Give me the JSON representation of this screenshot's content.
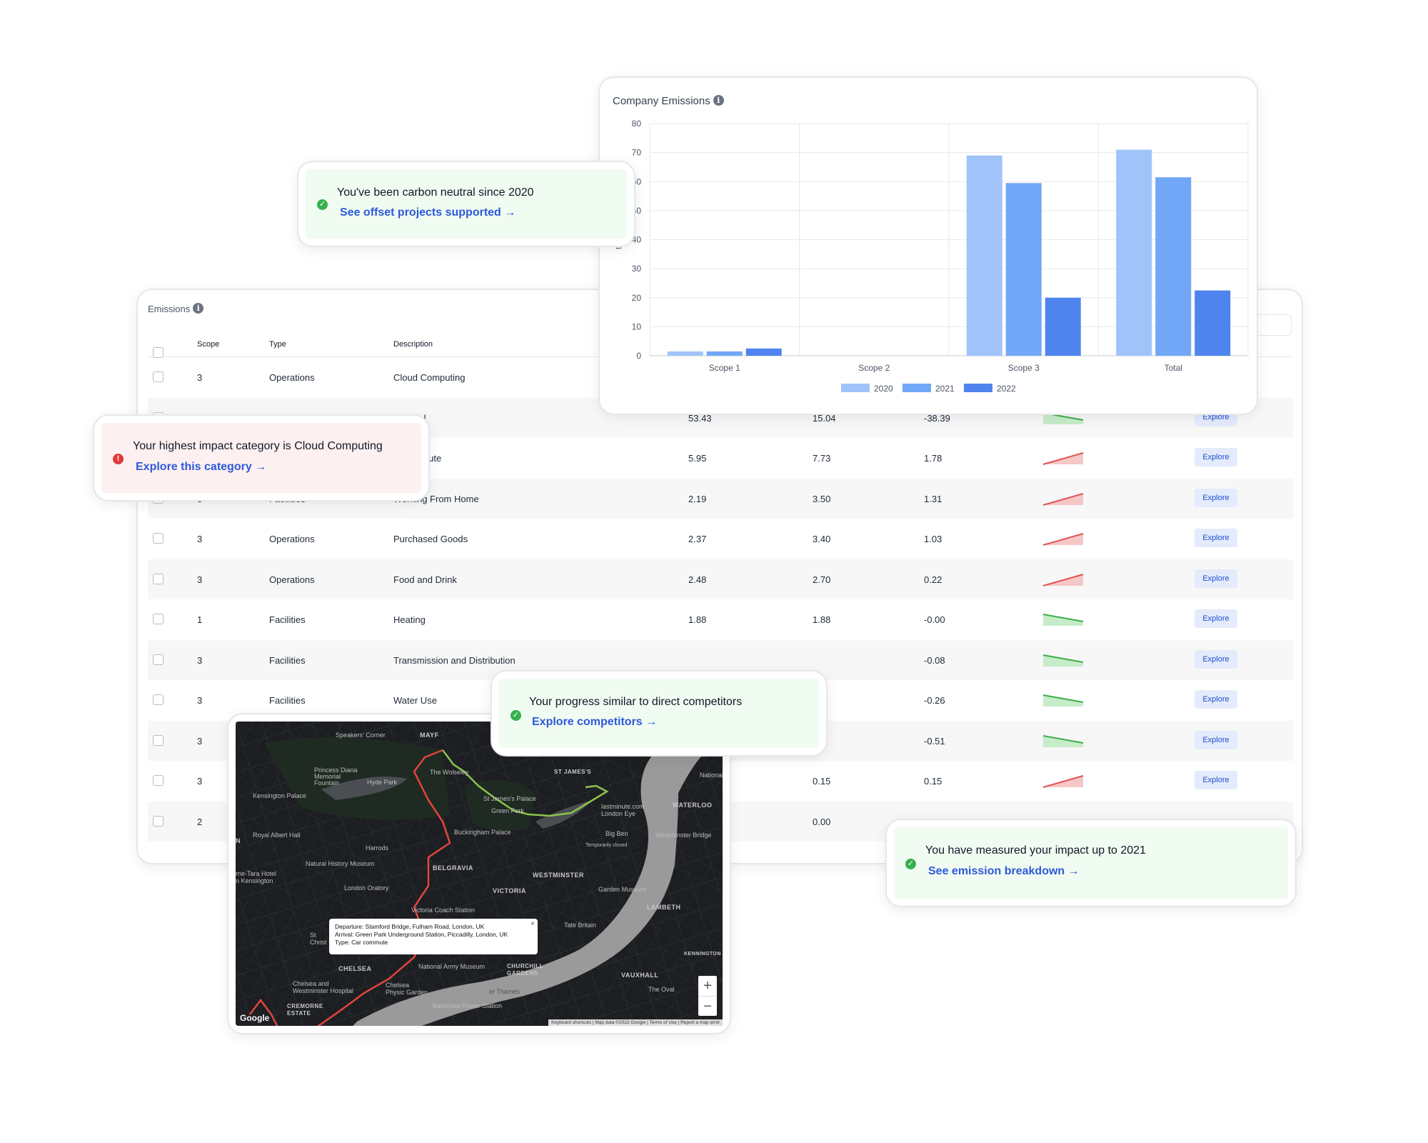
{
  "emissions_table": {
    "title": "Emissions",
    "columns": {
      "scope": "Scope",
      "type": "Type",
      "description": "Description"
    },
    "rows": [
      {
        "scope": "3",
        "type": "Operations",
        "description": "Cloud Computing",
        "v1": "",
        "v2": "",
        "v3": "",
        "trend": "",
        "explore": ""
      },
      {
        "scope": "",
        "type": "",
        "description": "s Travel",
        "v1": "53.43",
        "v2": "15.04",
        "v3": "-38.39",
        "trend": "down",
        "explore": "Explore"
      },
      {
        "scope": "",
        "type": "",
        "description": "e Commute",
        "v1": "5.95",
        "v2": "7.73",
        "v3": "1.78",
        "trend": "up",
        "explore": "Explore"
      },
      {
        "scope": "3",
        "type": "Facilities",
        "description": "Working From Home",
        "v1": "2.19",
        "v2": "3.50",
        "v3": "1.31",
        "trend": "up",
        "explore": "Explore"
      },
      {
        "scope": "3",
        "type": "Operations",
        "description": "Purchased Goods",
        "v1": "2.37",
        "v2": "3.40",
        "v3": "1.03",
        "trend": "up",
        "explore": "Explore"
      },
      {
        "scope": "3",
        "type": "Operations",
        "description": "Food and Drink",
        "v1": "2.48",
        "v2": "2.70",
        "v3": "0.22",
        "trend": "up",
        "explore": "Explore"
      },
      {
        "scope": "1",
        "type": "Facilities",
        "description": "Heating",
        "v1": "1.88",
        "v2": "1.88",
        "v3": "-0.00",
        "trend": "down",
        "explore": "Explore"
      },
      {
        "scope": "3",
        "type": "Facilities",
        "description": "Transmission and Distribution",
        "v1": "",
        "v2": "",
        "v3": "-0.08",
        "trend": "down",
        "explore": "Explore"
      },
      {
        "scope": "3",
        "type": "Facilities",
        "description": "Water Use",
        "v1": "",
        "v2": "",
        "v3": "-0.26",
        "trend": "down",
        "explore": "Explore"
      },
      {
        "scope": "3",
        "type": "",
        "description": "",
        "v1": "",
        "v2": "",
        "v3": "-0.51",
        "trend": "down",
        "explore": "Explore"
      },
      {
        "scope": "3",
        "type": "",
        "description": "",
        "v1": "",
        "v2": "0.15",
        "v3": "0.15",
        "trend": "up",
        "explore": "Explore"
      },
      {
        "scope": "2",
        "type": "",
        "description": "",
        "v1": "",
        "v2": "0.00",
        "v3": "",
        "trend": "",
        "explore": ""
      }
    ]
  },
  "chart_card": {
    "title": "Company Emissions"
  },
  "chart_data": {
    "type": "bar",
    "categories": [
      "Scope 1",
      "Scope 2",
      "Scope 3",
      "Total"
    ],
    "series": [
      {
        "name": "2020",
        "color": "#a0c4f9",
        "values": [
          1.5,
          0,
          69,
          71
        ]
      },
      {
        "name": "2021",
        "color": "#72a6f6",
        "values": [
          1.5,
          0,
          59.5,
          61.5
        ]
      },
      {
        "name": "2022",
        "color": "#4f84ee",
        "values": [
          2.5,
          0,
          20,
          22.5
        ]
      }
    ],
    "yticks": [
      0,
      10,
      20,
      30,
      40,
      50,
      60,
      70,
      80
    ],
    "ylim": [
      0,
      80
    ],
    "ylabel": "t(",
    "legend": "bottom",
    "grid": true
  },
  "notifications": {
    "neutral": {
      "title": "You've been carbon neutral since 2020",
      "link": "See offset projects supported →",
      "status": "success"
    },
    "impact": {
      "title": "Your highest impact category is Cloud Computing",
      "link": "Explore this category →",
      "status": "error"
    },
    "progress": {
      "title": "Your progress similar to direct competitors",
      "link": "Explore competitors →",
      "status": "success"
    },
    "measured": {
      "title": "You have measured your impact up to 2021",
      "link": "See emission breakdown →",
      "status": "success"
    }
  },
  "map": {
    "popup": {
      "departure": "Departure: Stamford Bridge, Fulham Road, London, UK",
      "arrival": "Arrival: Green Park Underground Station, Piccadilly, London, UK",
      "type": "Type: Car commute"
    },
    "labels": {
      "speakers_corner": "Speakers' Corner",
      "mayfair": "MAYF",
      "diana": "Princess Diana\nMemorial\nFountain",
      "hyde_park": "Hyde Park",
      "kensington_palace": "Kensington Palace",
      "wolseley": "The Wolseley",
      "st_james": "ST JAMES'S",
      "national": "National T",
      "st_james_palace": "St James's Palace",
      "green_park": "Green Park",
      "lastminute": "lastminute.com\nLondon Eye",
      "waterloo": "WATERLOO",
      "royal_albert": "Royal Albert Hall",
      "buckingham": "Buckingham Palace",
      "big_ben": "Big Ben",
      "westminster_bridge": "Westminster Bridge",
      "harrods": "Harrods",
      "nhm": "Natural History Museum",
      "belgravia": "BELGRAVIA",
      "westminster": "WESTMINSTER",
      "garden_museum": "Garden Museum",
      "hotel": "rne-Tara Hotel\nn Kensington",
      "oratory": "London Oratory",
      "victoria": "VICTORIA",
      "lambeth": "LAMBETH",
      "victoria_coach": "Victoria Coach Station",
      "tate": "Tate Britain",
      "chelsea": "CHELSEA",
      "national_army": "National Army Museum",
      "churchill": "CHURCHILL\nGARDENS",
      "kennington": "KENNINGTON",
      "vauxhall": "VAUXHALL",
      "chelsea_hospital": "Chelsea and\nWestminster Hospital",
      "physic": "Chelsea\nPhysic Garden",
      "oval": "The Oval",
      "cremorne": "CREMORNE\nESTATE",
      "battersea": "Battersea Power Station",
      "thames": "er Thames",
      "temp_closed": "Temporarily closed",
      "st_christ": "St\nChrist",
      "n_label": "N"
    },
    "zoom_in": "+",
    "zoom_out": "−",
    "google": "Google",
    "attribution": "Keyboard shortcuts | Map data ©2022 Google | Terms of Use | Report a map error"
  },
  "colors": {
    "accent": "#2d59dd",
    "success": "#35b04d",
    "error": "#e03a3a",
    "trend_up": "#e05555",
    "trend_down": "#3fae4a"
  },
  "icons": {
    "info": "info-icon",
    "check": "check-circle-icon",
    "alert": "alert-circle-icon"
  }
}
